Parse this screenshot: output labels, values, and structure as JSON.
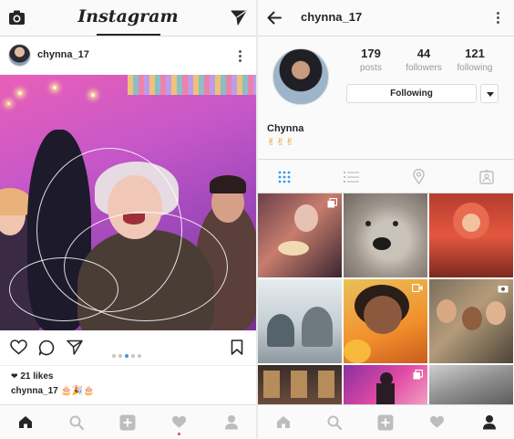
{
  "feed": {
    "logo": "Instagram",
    "post": {
      "username": "chynna_17",
      "likes": "21 likes",
      "caption_user": "chynna_17",
      "caption_text": "🎂🎉🎂",
      "carousel_pages": 5,
      "carousel_index": 3
    }
  },
  "profile": {
    "username": "chynna_17",
    "name": "Chynna",
    "bio": "✌✌✌",
    "stats": [
      {
        "value": "179",
        "label": "posts"
      },
      {
        "value": "44",
        "label": "followers"
      },
      {
        "value": "121",
        "label": "following"
      }
    ],
    "follow_button": "Following",
    "tabs": [
      "grid-view",
      "list-view",
      "location",
      "tagged"
    ],
    "active_tab": "grid-view"
  },
  "colors": {
    "accent_blue": "#3897f0",
    "notification_red": "#ed4956",
    "text": "#262626",
    "muted": "#999999"
  },
  "icons": {
    "feed_top": [
      "camera-icon",
      "direct-message-icon"
    ],
    "profile_top": [
      "back-arrow-icon",
      "more-options-icon"
    ],
    "post_actions": [
      "heart-icon",
      "comment-icon",
      "share-icon",
      "bookmark-icon"
    ],
    "bottom_nav": [
      "home-icon",
      "search-icon",
      "add-icon",
      "activity-heart-icon",
      "profile-icon"
    ]
  }
}
